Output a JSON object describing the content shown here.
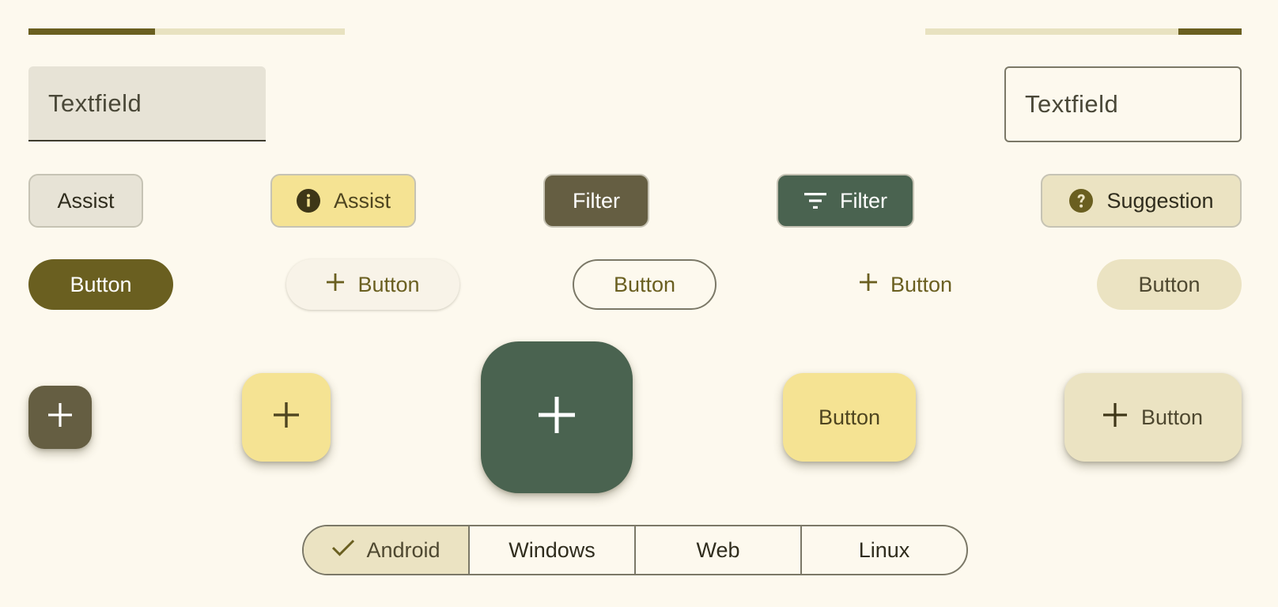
{
  "colors": {
    "background": "#FDF9EE",
    "primary": "#6A5F20",
    "tertiary_green": "#4A6350",
    "secondary": "#655E42",
    "yellow_container": "#F5E393",
    "secondary_container": "#EBE3C2",
    "track": "#E8E2C0"
  },
  "progress": {
    "left_value": 0.4,
    "right_value": 0.2
  },
  "textfields": {
    "filled_label": "Textfield",
    "outlined_label": "Textfield"
  },
  "chips": {
    "assist_plain": "Assist",
    "assist_elevated": "Assist",
    "assist_elevated_icon": "info-icon",
    "filter_selected": "Filter",
    "filter_icon_chip": "Filter",
    "filter_icon": "filter-icon",
    "suggestion": "Suggestion",
    "suggestion_icon": "help-icon"
  },
  "buttons": {
    "filled": "Button",
    "elevated": "Button",
    "outlined": "Button",
    "text": "Button",
    "tonal": "Button",
    "add_icon": "plus-icon"
  },
  "fabs": {
    "small_icon": "plus-icon",
    "regular_icon": "plus-icon",
    "large_icon": "plus-icon",
    "extended_label": "Button",
    "extended_icon_label": "Button"
  },
  "segmented": {
    "items": [
      "Android",
      "Windows",
      "Web",
      "Linux"
    ],
    "selected_index": 0,
    "check_icon": "check-icon"
  }
}
